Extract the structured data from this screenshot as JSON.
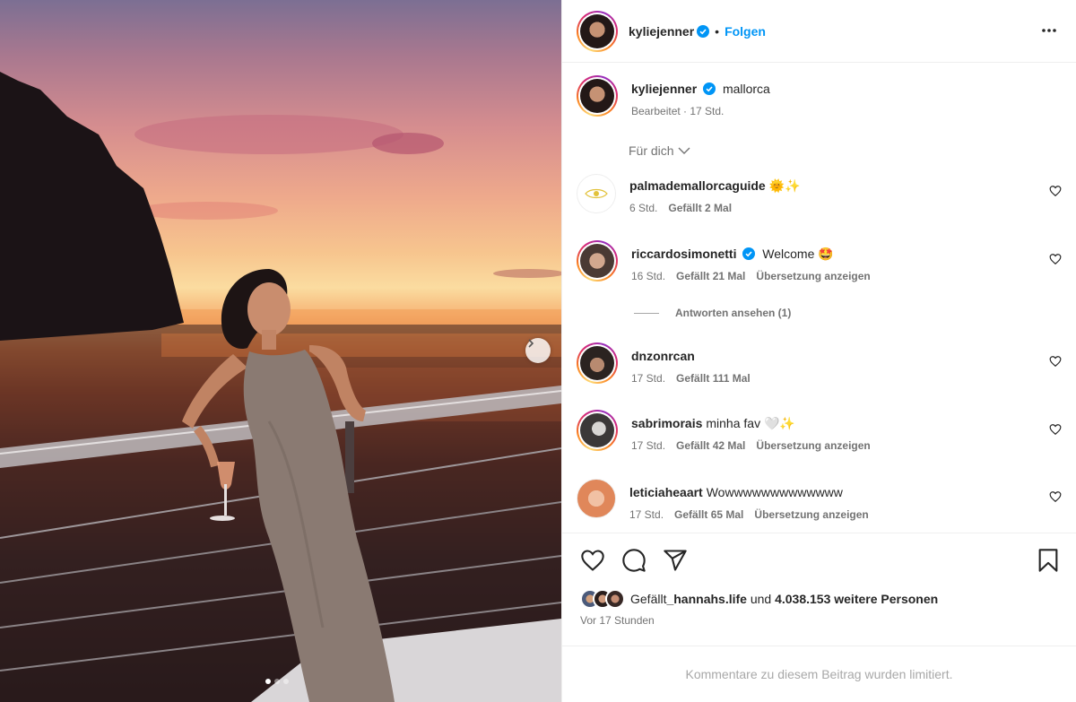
{
  "post": {
    "username": "kyliejenner",
    "follow_label": "Folgen",
    "separator": "•",
    "caption": "mallorca",
    "edited_meta": "Bearbeitet · 17 Std.",
    "carousel_index": 1,
    "carousel_count": 3
  },
  "comments_filter": "Für dich",
  "comments": [
    {
      "username": "palmademallorcaguide",
      "text": "🌞✨",
      "time": "6 Std.",
      "likes": "Gefällt 2 Mal",
      "translate": ""
    },
    {
      "username": "riccardosimonetti",
      "text": "Welcome 🤩",
      "time": "16 Std.",
      "likes": "Gefällt 21 Mal",
      "translate": "Übersetzung anzeigen"
    },
    {
      "username": "dnzonrcan",
      "text": "",
      "time": "17 Std.",
      "likes": "Gefällt 111 Mal",
      "translate": ""
    },
    {
      "username": "sabrimorais",
      "text": "minha fav 🤍✨",
      "time": "17 Std.",
      "likes": "Gefällt 42 Mal",
      "translate": "Übersetzung anzeigen"
    },
    {
      "username": "leticiaheaart",
      "text": "Wowwwwwwwwwwwww",
      "time": "17 Std.",
      "likes": "Gefällt 65 Mal",
      "translate": "Übersetzung anzeigen"
    }
  ],
  "replies_label": "Antworten ansehen (1)",
  "likes_line": {
    "prefix": "Gefällt ",
    "user": "_hannahs.life",
    "middle": " und ",
    "count": "4.038.153 weitere Personen"
  },
  "posted_ago": "Vor 17 Stunden",
  "comments_limited": "Kommentare zu diesem Beitrag wurden limitiert.",
  "colors": {
    "accent": "#0095f6",
    "verified": "#0095f6",
    "muted": "#737373"
  }
}
